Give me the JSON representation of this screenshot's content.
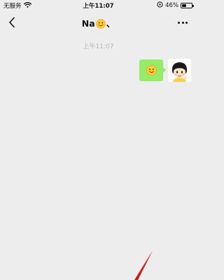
{
  "status_bar": {
    "carrier": "无服务",
    "time": "上午11:07",
    "battery_percent": "46%",
    "battery_level": 0.46
  },
  "nav": {
    "title_prefix": "Na",
    "title_suffix": "、",
    "title_emoji": "smiling-face-emoji"
  },
  "chat": {
    "timestamp": "上午11:07",
    "messages": [
      {
        "from": "me",
        "type": "emoji",
        "emoji": "smiling-face-emoji"
      }
    ]
  },
  "colors": {
    "background": "#ededed",
    "bubble_green": "#95ec69",
    "timestamp_gray": "#b2b2b2",
    "annotation_red": "#d0191b"
  },
  "icons": {
    "back": "chevron-left-icon",
    "more": "more-dots-icon",
    "wifi": "wifi-icon",
    "location": "location-lock-icon",
    "battery": "battery-icon"
  }
}
